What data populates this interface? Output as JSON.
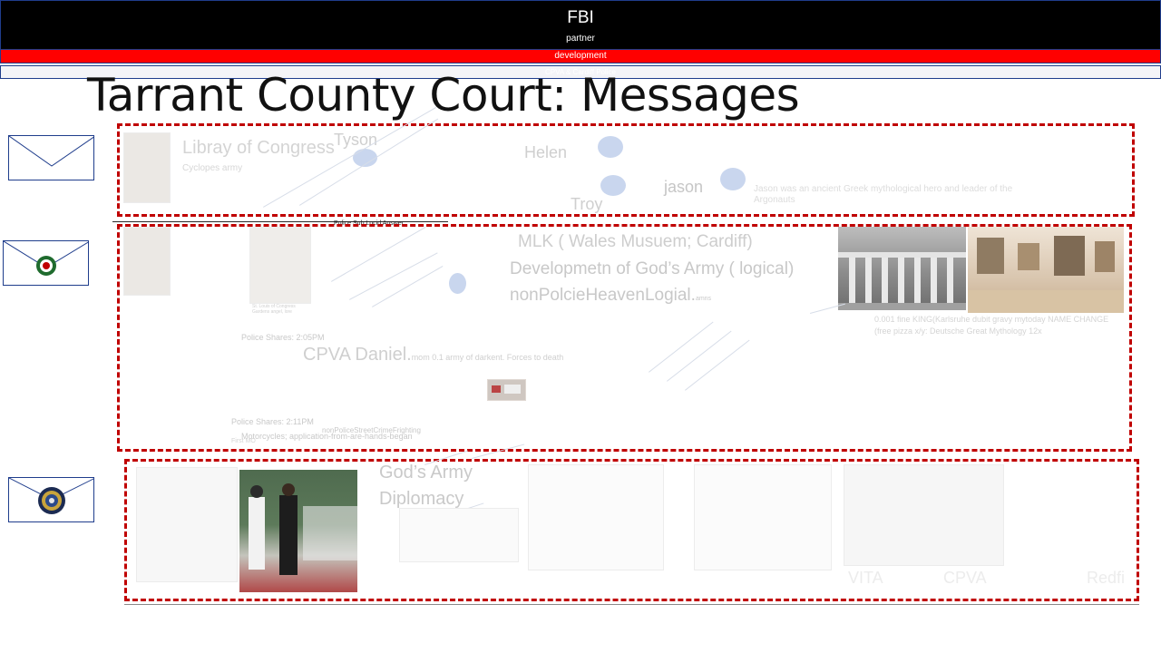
{
  "header": {
    "title": "FBI",
    "subtitle": "partner"
  },
  "bars": {
    "development": "development",
    "faint_label": "CPVA & Cardiff Police"
  },
  "page_title": "Tarrant County Court: Messages",
  "row1": {
    "heading": "Libray of Congress",
    "subheading": "Cyclopes army",
    "name_tyson": "Tyson",
    "name_helen": "Helen",
    "name_troy": "Troy",
    "name_jason": "jason",
    "jason_note": "Jason was an ancient Greek mythological hero and leader of the Argonauts",
    "divider_label": "Police Sub Lucid Answer"
  },
  "row2": {
    "mlk": "MLK ( Wales Musuem; Cardiff)",
    "development": "Developmetn of God’s Army ( logical)",
    "nonpolice": "nonPolcieHeavenLogial.",
    "nonpolice_suffix": "amns",
    "photo_caption": "St. Louis of Congress Gardens angel, lore",
    "shares_1": "Police Shares: 2:05PM",
    "cpva": "CPVA Daniel.",
    "cpva_suffix": "mom 0.1 army of darkent. Forces to death",
    "shares_2": "Police Shares: 2:11PM",
    "street_crime": "nonPoliceStreetCrimeFrighting",
    "motorcycles": "Motorcycles; application-from-are-hands-began",
    "first": "First MO",
    "museum_note_1": "0.001 fine KING(Karlsruhe dubit gravy mytoday NAME CHANGE",
    "museum_note_2": "(free pizza x/y: Deutsche Great Mythology 12x"
  },
  "row3": {
    "gods_army": "God’s Army",
    "diplomacy": "Diplomacy",
    "faint_a": "VITA",
    "faint_b": "CPVA",
    "faint_c": "Redfi"
  },
  "colors": {
    "accent_red": "#c00000",
    "header_bg": "#000000",
    "border_blue": "#1f3d8c"
  },
  "icons": {
    "envelope_plain": "envelope-icon",
    "envelope_wales": "envelope-wales-seal-icon",
    "envelope_dod": "envelope-dod-seal-icon"
  }
}
